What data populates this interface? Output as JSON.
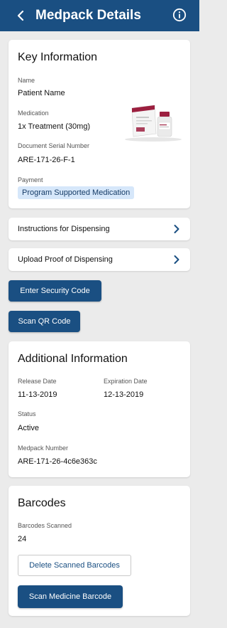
{
  "header": {
    "title": "Medpack Details",
    "back_icon": "chevron-left-icon",
    "info_icon": "info-icon"
  },
  "key_info": {
    "title": "Key Information",
    "name_label": "Name",
    "name_value": "Patient Name",
    "medication_label": "Medication",
    "medication_value": "1x Treatment (30mg)",
    "serial_label": "Document Serial Number",
    "serial_value": "ARE-171-26-F-1",
    "payment_label": "Payment",
    "payment_value": "Program Supported Medication"
  },
  "rows": {
    "instructions_label": "Instructions for Dispensing",
    "upload_label": "Upload Proof of Dispensing"
  },
  "buttons": {
    "security_code": "Enter Security Code",
    "scan_qr": "Scan QR Code"
  },
  "additional_info": {
    "title": "Additional Information",
    "release_label": "Release Date",
    "release_value": "11-13-2019",
    "expiration_label": "Expiration Date",
    "expiration_value": "12-13-2019",
    "status_label": "Status",
    "status_value": "Active",
    "medpack_label": "Medpack Number",
    "medpack_value": "ARE-171-26-4c6e363c"
  },
  "barcodes": {
    "title": "Barcodes",
    "scanned_label": "Barcodes Scanned",
    "scanned_value": "24",
    "delete_label": "Delete Scanned Barcodes",
    "scan_label": "Scan Medicine Barcode"
  },
  "colors": {
    "primary": "#1a4f82",
    "pill_bg": "#d6e7fa",
    "background": "#ebebeb"
  }
}
